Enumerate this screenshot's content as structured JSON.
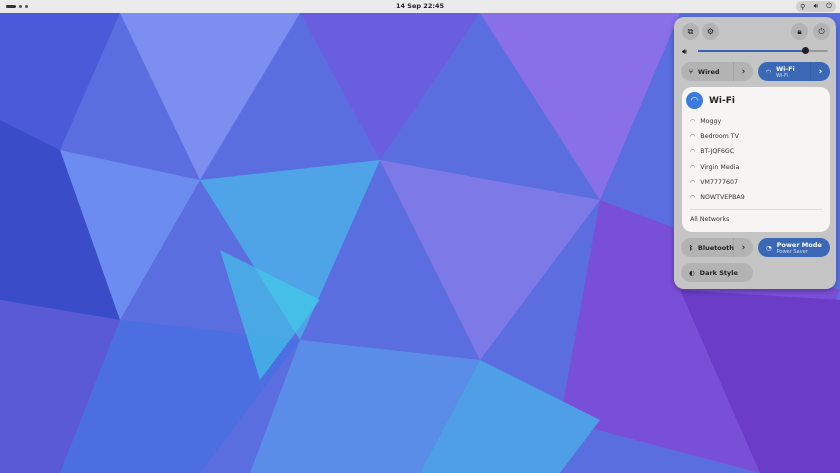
{
  "topbar": {
    "clock": "14 Sep  22:45",
    "status_icons": [
      "location-icon",
      "volume-icon",
      "power-icon"
    ]
  },
  "quick_settings": {
    "volume_level": 0.82,
    "wired": {
      "label": "Wired"
    },
    "wifi": {
      "label": "Wi-Fi",
      "sublabel": "Wi-Fi"
    },
    "wifi_menu": {
      "title": "Wi-Fi",
      "networks": [
        "Moggy",
        "Bedroom TV",
        "BT-JQF6GC",
        "Virgin Media",
        "VM7777607",
        "NOWTVEPBA9"
      ],
      "all_networks": "All Networks"
    },
    "bluetooth": {
      "label": "Bluetooth"
    },
    "power_mode": {
      "label": "Power Mode",
      "sublabel": "Power Saver"
    },
    "dark_style": {
      "label": "Dark Style"
    }
  }
}
